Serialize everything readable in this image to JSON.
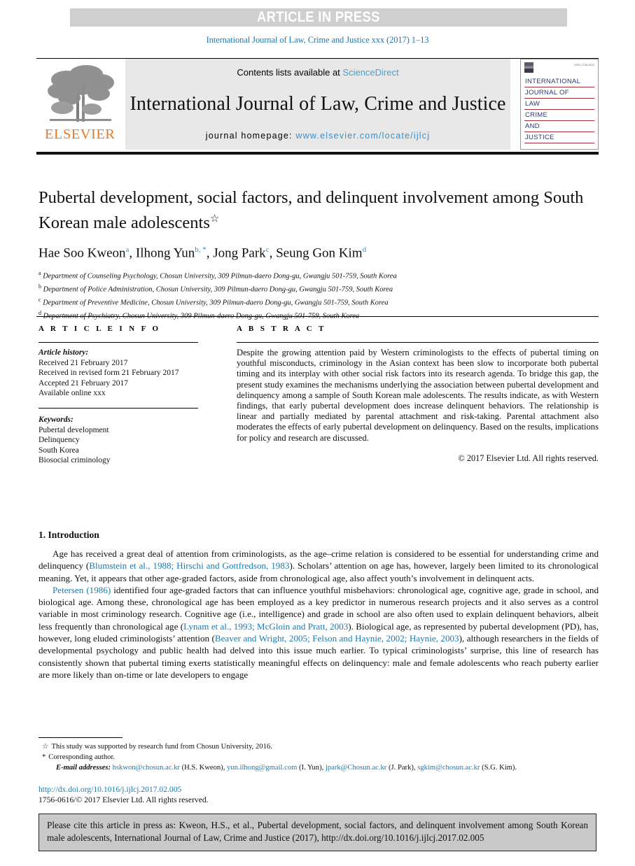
{
  "banner": {
    "text": "ARTICLE IN PRESS"
  },
  "running_head": "International Journal of Law, Crime and Justice xxx (2017) 1–13",
  "masthead": {
    "contents_prefix": "Contents lists available at ",
    "sciencedirect": "ScienceDirect",
    "journal_title": "International Journal of Law, Crime and Justice",
    "homepage_label": "journal homepage: ",
    "homepage_url": "www.elsevier.com/locate/ijlcj",
    "publisher": "ELSEVIER",
    "cover_lines": [
      "INTERNATIONAL",
      "JOURNAL OF",
      "LAW",
      "CRIME",
      "AND",
      "JUSTICE"
    ],
    "cover_tiny": "ISSN 1756-0616"
  },
  "article": {
    "title": "Pubertal development, social factors, and delinquent involvement among South Korean male adolescents",
    "title_marker": "☆",
    "authors": [
      {
        "name": "Hae Soo Kweon",
        "sup": "a"
      },
      {
        "name": "Ilhong Yun",
        "sup": "b, *"
      },
      {
        "name": "Jong Park",
        "sup": "c"
      },
      {
        "name": "Seung Gon Kim",
        "sup": "d"
      }
    ],
    "affiliations": [
      {
        "label": "a",
        "text": "Department of Counseling Psychology, Chosun University, 309 Pilmun-daero Dong-gu, Gwangju 501-759, South Korea"
      },
      {
        "label": "b",
        "text": "Department of Police Administration, Chosun University, 309 Pilmun-daero Dong-gu, Gwangju 501-759, South Korea"
      },
      {
        "label": "c",
        "text": "Department of Preventive Medicine, Chosun University, 309 Pilmun-daero Dong-gu, Gwangju 501-759, South Korea"
      },
      {
        "label": "d",
        "text": "Department of Psychiatry, Chosun University, 309 Pilmun-daero Dong-gu, Gwangju 501-759, South Korea"
      }
    ]
  },
  "article_info": {
    "heading": "A R T I C L E  I N F O",
    "history_label": "Article history:",
    "history": [
      "Received 21 February 2017",
      "Received in revised form 21 February 2017",
      "Accepted 21 February 2017",
      "Available online xxx"
    ],
    "keywords_label": "Keywords:",
    "keywords": [
      "Pubertal development",
      "Delinquency",
      "South Korea",
      "Biosocial criminology"
    ]
  },
  "abstract": {
    "heading": "A B S T R A C T",
    "text": "Despite the growing attention paid by Western criminologists to the effects of pubertal timing on youthful misconducts, criminology in the Asian context has been slow to incorporate both pubertal timing and its interplay with other social risk factors into its research agenda. To bridge this gap, the present study examines the mechanisms underlying the association between pubertal development and delinquency among a sample of South Korean male adolescents. The results indicate, as with Western findings, that early pubertal development does increase delinquent behaviors. The relationship is linear and partially mediated by parental attachment and risk-taking. Parental attachment also moderates the effects of early pubertal development on delinquency. Based on the results, implications for policy and research are discussed.",
    "copyright": "© 2017 Elsevier Ltd. All rights reserved."
  },
  "body": {
    "section_title": "1. Introduction",
    "paragraph1_a": "Age has received a great deal of attention from criminologists, as the age–crime relation is considered to be essential for understanding crime and delinquency (",
    "paragraph1_ref": "Blumstein et al., 1988; Hirschi and Gottfredson, 1983",
    "paragraph1_b": "). Scholars’ attention on age has, however, largely been limited to its chronological meaning. Yet, it appears that other age-graded factors, aside from chronological age, also affect youth’s involvement in delinquent acts.",
    "paragraph2_ref1": "Petersen (1986)",
    "paragraph2_a": " identified four age-graded factors that can influence youthful misbehaviors: chronological age, cognitive age, grade in school, and biological age. Among these, chronological age has been employed as a key predictor in numerous research projects and it also serves as a control variable in most criminology research. Cognitive age (i.e., intelligence) and grade in school are also often used to explain delinquent behaviors, albeit less frequently than chronological age (",
    "paragraph2_ref2": "Lynam et al., 1993; McGloin and Pratt, 2003",
    "paragraph2_b": "). Biological age, as represented by pubertal development (PD), has, however, long eluded criminologists’ attention (",
    "paragraph2_ref3": "Beaver and Wright, 2005; Felson and Haynie, 2002; Haynie, 2003",
    "paragraph2_c": "), although researchers in the fields of developmental psychology and public health had delved into this issue much earlier. To typical criminologists’ surprise, this line of research has consistently shown that pubertal timing exerts statistically meaningful effects on delinquency: male and female adolescents who reach puberty earlier are more likely than on-time or late developers to engage"
  },
  "footnotes": {
    "star_marker": "☆",
    "star_text": "This study was supported by research fund from Chosun University, 2016.",
    "corr_marker": "*",
    "corr_text": "Corresponding author.",
    "email_label": "E-mail addresses:",
    "emails": [
      {
        "address": "hskwon@chosun.ac.kr",
        "person": "(H.S. Kweon)"
      },
      {
        "address": "yun.ilhong@gmail.com",
        "person": "(I. Yun)"
      },
      {
        "address": "jpark@Chosun.ac.kr",
        "person": "(J. Park)"
      },
      {
        "address": "sgkim@chosun.ac.kr",
        "person": "(S.G. Kim)"
      }
    ],
    "doi_url": "http://dx.doi.org/10.1016/j.ijlcj.2017.02.005",
    "issn_line": "1756-0616/© 2017 Elsevier Ltd. All rights reserved."
  },
  "cite_box": {
    "text": "Please cite this article in press as: Kweon, H.S., et al., Pubertal development, social factors, and delinquent involvement among South Korean male adolescents, International Journal of Law, Crime and Justice (2017), http://dx.doi.org/10.1016/j.ijlcj.2017.02.005"
  },
  "colors": {
    "link": "#1a7bb0",
    "elsevier_orange": "#e87722",
    "banner_bg": "#cfcfcf",
    "masthead_bg": "#e8e8e8",
    "cite_bg": "#c9c9c9"
  }
}
